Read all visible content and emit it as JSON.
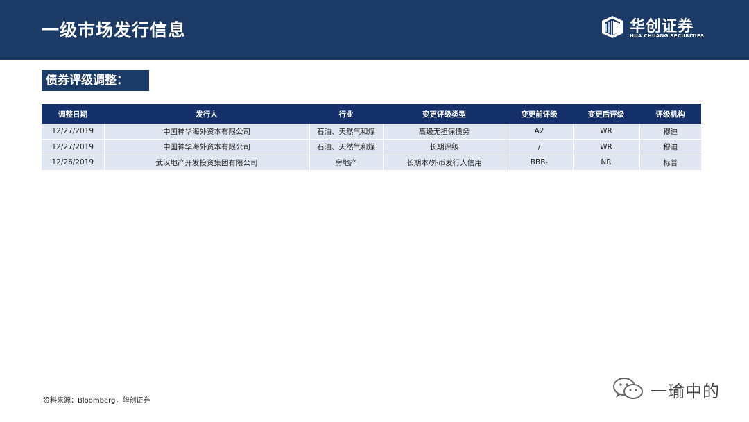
{
  "header": {
    "title": "一级市场发行信息",
    "logo_cn": "华创证券",
    "logo_en": "HUA CHUANG SECURITIES"
  },
  "section": {
    "label": "债券评级调整："
  },
  "table": {
    "columns": [
      "调整日期",
      "发行人",
      "行业",
      "变更评级类型",
      "变更前评级",
      "变更后评级",
      "评级机构"
    ],
    "rows": [
      [
        "12/27/2019",
        "中国神华海外资本有限公司",
        "石油、天然气和煤",
        "高级无担保债务",
        "A2",
        "WR",
        "穆迪"
      ],
      [
        "12/27/2019",
        "中国神华海外资本有限公司",
        "石油、天然气和煤",
        "长期评级",
        "/",
        "WR",
        "穆迪"
      ],
      [
        "12/26/2019",
        "武汉地产开发投资集团有限公司",
        "房地产",
        "长期本/外币发行人信用",
        "BBB-",
        "NR",
        "标普"
      ]
    ]
  },
  "footer": {
    "source": "资料来源：Bloomberg，华创证券"
  },
  "watermark": {
    "text": "一瑜中的"
  },
  "colors": {
    "header_bg": "#1c3a66",
    "table_header_bg": "#14306a",
    "row_bg": "#dfe6f1"
  },
  "icons": {
    "logo": "cube-logo-icon",
    "watermark": "wechat-icon"
  }
}
